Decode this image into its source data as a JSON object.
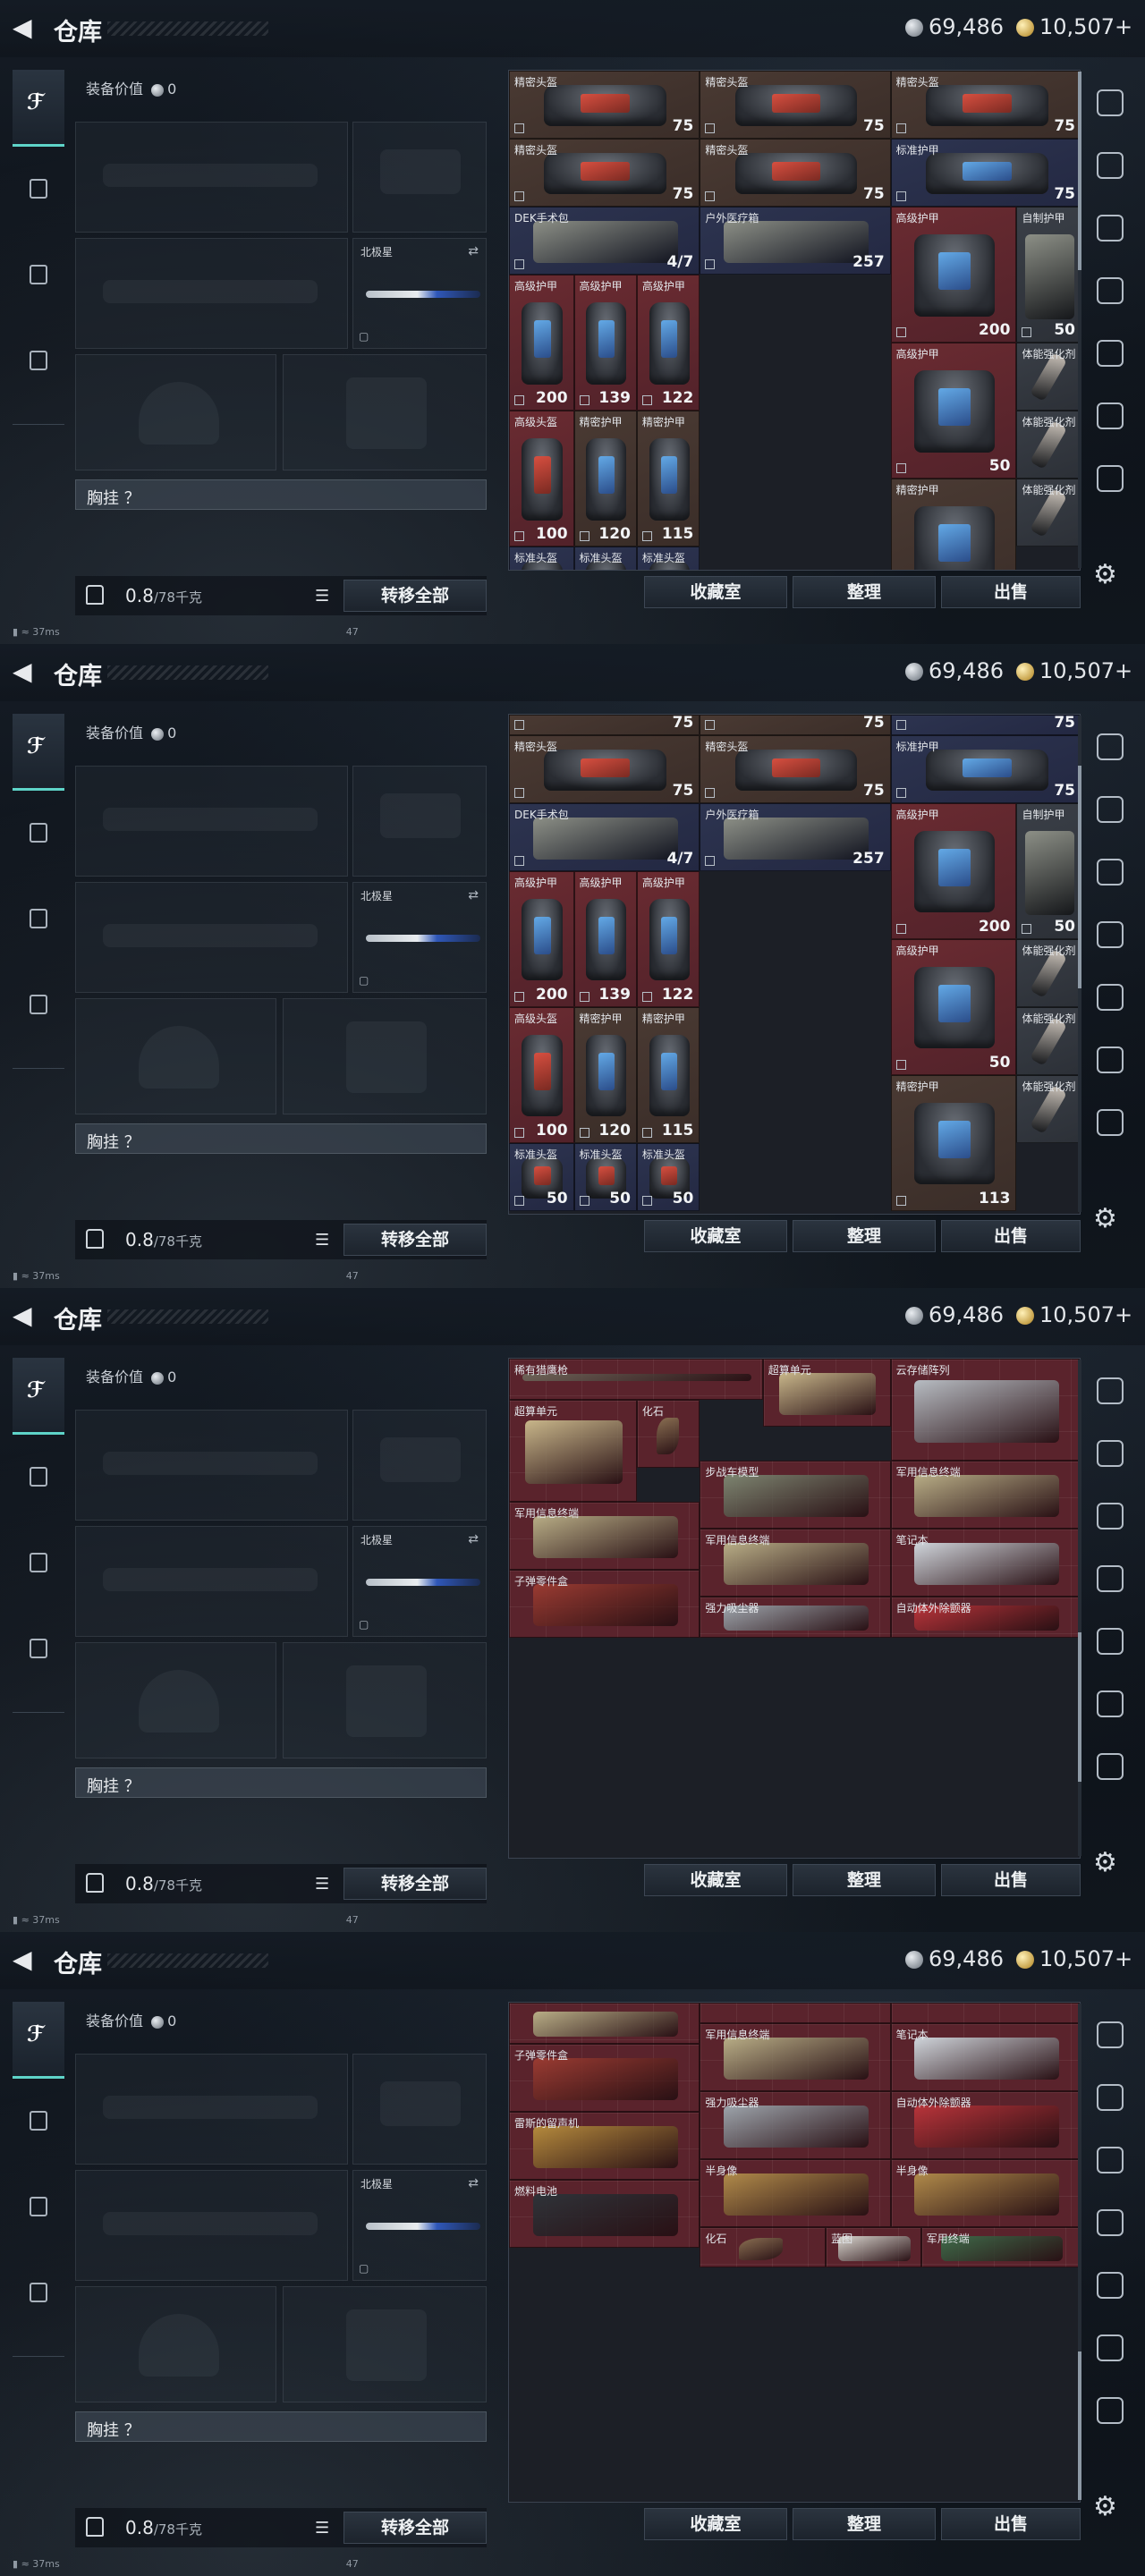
{
  "header": {
    "title": "仓库",
    "silver": "69,486",
    "gold": "10,507+"
  },
  "equipment": {
    "value_label": "装备价值",
    "value": "0",
    "knife_label": "北极星",
    "rig_label": "胸挂 ？"
  },
  "bottom": {
    "weight": "0.8",
    "weight_max": "/78千克",
    "transfer_all": "转移全部",
    "collection": "收藏室",
    "organize": "整理",
    "sell": "出售"
  },
  "status": {
    "ping": "37ms",
    "num": "47"
  },
  "panels": [
    {
      "scroll": {
        "from": 0.0,
        "to": 0.4
      },
      "cells": [
        {
          "name": "精密头盔",
          "val": "75",
          "c": 0,
          "r": 0,
          "w": 1,
          "h": 1,
          "k": "brown",
          "art": "bag-red"
        },
        {
          "name": "精密头盔",
          "val": "75",
          "c": 1,
          "r": 0,
          "w": 1,
          "h": 1,
          "k": "brown",
          "art": "bag-red"
        },
        {
          "name": "精密头盔",
          "val": "75",
          "c": 2,
          "r": 0,
          "w": 1,
          "h": 1,
          "k": "brown",
          "art": "bag-red"
        },
        {
          "name": "精密头盔",
          "val": "75",
          "c": 0,
          "r": 1,
          "w": 1,
          "h": 1,
          "k": "brown",
          "art": "bag-red"
        },
        {
          "name": "精密头盔",
          "val": "75",
          "c": 1,
          "r": 1,
          "w": 1,
          "h": 1,
          "k": "brown",
          "art": "bag-red"
        },
        {
          "name": "标准护甲",
          "val": "75",
          "c": 2,
          "r": 1,
          "w": 1,
          "h": 1,
          "k": "blue",
          "art": "bag-blue"
        },
        {
          "name": "DEK手术包",
          "val": "4/7",
          "c": 0,
          "r": 2,
          "w": 1,
          "h": 1,
          "k": "blue",
          "art": "box"
        },
        {
          "name": "户外医疗箱",
          "val": "257",
          "c": 1,
          "r": 2,
          "w": 1,
          "h": 1,
          "k": "blue",
          "art": "box"
        },
        {
          "name": "高级护甲",
          "val": "200",
          "c": 2,
          "r": 2,
          "w": 0.66,
          "h": 2,
          "k": "red",
          "art": "bag-blue"
        },
        {
          "name": "自制护甲",
          "val": "50",
          "c": 2.66,
          "r": 2,
          "w": 0.34,
          "h": 2,
          "k": "gray",
          "art": "box"
        },
        {
          "name": "高级护甲",
          "val": "200",
          "c": 0,
          "r": 3,
          "w": 0.34,
          "h": 2,
          "k": "red",
          "art": "bag-blue"
        },
        {
          "name": "高级护甲",
          "val": "139",
          "c": 0.34,
          "r": 3,
          "w": 0.33,
          "h": 2,
          "k": "red",
          "art": "bag-blue"
        },
        {
          "name": "高级护甲",
          "val": "122",
          "c": 0.67,
          "r": 3,
          "w": 0.33,
          "h": 2,
          "k": "red",
          "art": "bag-blue"
        },
        {
          "name": "高级护甲",
          "val": "50",
          "c": 2,
          "r": 4,
          "w": 0.66,
          "h": 2,
          "k": "red",
          "art": "bag-blue"
        },
        {
          "name": "体能强化剂",
          "val": "",
          "c": 2.66,
          "r": 4,
          "w": 0.34,
          "h": 1,
          "k": "gray",
          "art": "syringe"
        },
        {
          "name": "高级头盔",
          "val": "100",
          "c": 0,
          "r": 5,
          "w": 0.34,
          "h": 2,
          "k": "red",
          "art": "bag-red"
        },
        {
          "name": "精密护甲",
          "val": "120",
          "c": 0.34,
          "r": 5,
          "w": 0.33,
          "h": 2,
          "k": "brown",
          "art": "bag-blue"
        },
        {
          "name": "精密护甲",
          "val": "115",
          "c": 0.67,
          "r": 5,
          "w": 0.33,
          "h": 2,
          "k": "brown",
          "art": "bag-blue"
        },
        {
          "name": "体能强化剂",
          "val": "",
          "c": 2.66,
          "r": 5,
          "w": 0.34,
          "h": 1,
          "k": "gray",
          "art": "syringe"
        },
        {
          "name": "精密护甲",
          "val": "113",
          "c": 2,
          "r": 6,
          "w": 0.66,
          "h": 2,
          "k": "brown",
          "art": "bag-blue"
        },
        {
          "name": "体能强化剂",
          "val": "",
          "c": 2.66,
          "r": 6,
          "w": 0.34,
          "h": 1,
          "k": "gray",
          "art": "syringe"
        },
        {
          "name": "标准头盔",
          "val": "50",
          "c": 0,
          "r": 7,
          "w": 0.34,
          "h": 1,
          "k": "blue",
          "art": "bag-red"
        },
        {
          "name": "标准头盔",
          "val": "50",
          "c": 0.34,
          "r": 7,
          "w": 0.33,
          "h": 1,
          "k": "blue",
          "art": "bag-red"
        },
        {
          "name": "标准头盔",
          "val": "50",
          "c": 0.67,
          "r": 7,
          "w": 0.33,
          "h": 1,
          "k": "blue",
          "art": "bag-red"
        }
      ]
    },
    {
      "scroll": {
        "from": 0.1,
        "to": 0.55
      },
      "cells": [
        {
          "name": "",
          "val": "75",
          "c": 0,
          "r": 0,
          "w": 1,
          "h": 0.3,
          "k": "brown",
          "art": ""
        },
        {
          "name": "",
          "val": "75",
          "c": 1,
          "r": 0,
          "w": 1,
          "h": 0.3,
          "k": "brown",
          "art": ""
        },
        {
          "name": "",
          "val": "75",
          "c": 2,
          "r": 0,
          "w": 1,
          "h": 0.3,
          "k": "blue",
          "art": ""
        },
        {
          "name": "精密头盔",
          "val": "75",
          "c": 0,
          "r": 0.3,
          "w": 1,
          "h": 1,
          "k": "brown",
          "art": "bag-red"
        },
        {
          "name": "精密头盔",
          "val": "75",
          "c": 1,
          "r": 0.3,
          "w": 1,
          "h": 1,
          "k": "brown",
          "art": "bag-red"
        },
        {
          "name": "标准护甲",
          "val": "75",
          "c": 2,
          "r": 0.3,
          "w": 1,
          "h": 1,
          "k": "blue",
          "art": "bag-blue"
        },
        {
          "name": "DEK手术包",
          "val": "4/7",
          "c": 0,
          "r": 1.3,
          "w": 1,
          "h": 1,
          "k": "blue",
          "art": "box"
        },
        {
          "name": "户外医疗箱",
          "val": "257",
          "c": 1,
          "r": 1.3,
          "w": 1,
          "h": 1,
          "k": "blue",
          "art": "box"
        },
        {
          "name": "高级护甲",
          "val": "200",
          "c": 2,
          "r": 1.3,
          "w": 0.66,
          "h": 2,
          "k": "red",
          "art": "bag-blue"
        },
        {
          "name": "自制护甲",
          "val": "50",
          "c": 2.66,
          "r": 1.3,
          "w": 0.34,
          "h": 2,
          "k": "gray",
          "art": "box"
        },
        {
          "name": "高级护甲",
          "val": "200",
          "c": 0,
          "r": 2.3,
          "w": 0.34,
          "h": 2,
          "k": "red",
          "art": "bag-blue"
        },
        {
          "name": "高级护甲",
          "val": "139",
          "c": 0.34,
          "r": 2.3,
          "w": 0.33,
          "h": 2,
          "k": "red",
          "art": "bag-blue"
        },
        {
          "name": "高级护甲",
          "val": "122",
          "c": 0.67,
          "r": 2.3,
          "w": 0.33,
          "h": 2,
          "k": "red",
          "art": "bag-blue"
        },
        {
          "name": "高级护甲",
          "val": "50",
          "c": 2,
          "r": 3.3,
          "w": 0.66,
          "h": 2,
          "k": "red",
          "art": "bag-blue"
        },
        {
          "name": "体能强化剂",
          "val": "",
          "c": 2.66,
          "r": 3.3,
          "w": 0.34,
          "h": 1,
          "k": "gray",
          "art": "syringe"
        },
        {
          "name": "高级头盔",
          "val": "100",
          "c": 0,
          "r": 4.3,
          "w": 0.34,
          "h": 2,
          "k": "red",
          "art": "bag-red"
        },
        {
          "name": "精密护甲",
          "val": "120",
          "c": 0.34,
          "r": 4.3,
          "w": 0.33,
          "h": 2,
          "k": "brown",
          "art": "bag-blue"
        },
        {
          "name": "精密护甲",
          "val": "115",
          "c": 0.67,
          "r": 4.3,
          "w": 0.33,
          "h": 2,
          "k": "brown",
          "art": "bag-blue"
        },
        {
          "name": "体能强化剂",
          "val": "",
          "c": 2.66,
          "r": 4.3,
          "w": 0.34,
          "h": 1,
          "k": "gray",
          "art": "syringe"
        },
        {
          "name": "精密护甲",
          "val": "113",
          "c": 2,
          "r": 5.3,
          "w": 0.66,
          "h": 2,
          "k": "brown",
          "art": "bag-blue"
        },
        {
          "name": "体能强化剂",
          "val": "",
          "c": 2.66,
          "r": 5.3,
          "w": 0.34,
          "h": 1,
          "k": "gray",
          "art": "syringe"
        },
        {
          "name": "标准头盔",
          "val": "50",
          "c": 0,
          "r": 6.3,
          "w": 0.34,
          "h": 1,
          "k": "blue",
          "art": "bag-red"
        },
        {
          "name": "标准头盔",
          "val": "50",
          "c": 0.34,
          "r": 6.3,
          "w": 0.33,
          "h": 1,
          "k": "blue",
          "art": "bag-red"
        },
        {
          "name": "标准头盔",
          "val": "50",
          "c": 0.67,
          "r": 6.3,
          "w": 0.33,
          "h": 1,
          "k": "blue",
          "art": "bag-red"
        }
      ]
    },
    {
      "scroll": {
        "from": 0.55,
        "to": 0.85
      },
      "cells": [
        {
          "name": "稀有猎鹰枪",
          "val": "",
          "c": 0,
          "r": 0,
          "w": 1.33,
          "h": 0.6,
          "k": "grid-bg",
          "art": "rifle"
        },
        {
          "name": "超算单元",
          "val": "",
          "c": 1.33,
          "r": 0,
          "w": 0.67,
          "h": 1,
          "k": "grid-bg",
          "art": "board"
        },
        {
          "name": "云存储阵列",
          "val": "",
          "c": 2,
          "r": 0,
          "w": 1,
          "h": 1.5,
          "k": "grid-bg",
          "art": "server"
        },
        {
          "name": "超算单元",
          "val": "",
          "c": 0,
          "r": 0.6,
          "w": 0.67,
          "h": 1.5,
          "k": "grid-bg",
          "art": "board"
        },
        {
          "name": "化石",
          "val": "",
          "c": 0.67,
          "r": 0.6,
          "w": 0.33,
          "h": 1,
          "k": "grid-bg",
          "art": "claw"
        },
        {
          "name": "步战车模型",
          "val": "",
          "c": 1,
          "r": 1.5,
          "w": 1,
          "h": 1,
          "k": "grid-bg",
          "art": "tank"
        },
        {
          "name": "军用信息终端",
          "val": "",
          "c": 2,
          "r": 1.5,
          "w": 1,
          "h": 1,
          "k": "grid-bg",
          "art": "terminal"
        },
        {
          "name": "军用信息终端",
          "val": "",
          "c": 0,
          "r": 2.1,
          "w": 1,
          "h": 1,
          "k": "grid-bg",
          "art": "terminal"
        },
        {
          "name": "军用信息终端",
          "val": "",
          "c": 1,
          "r": 2.5,
          "w": 1,
          "h": 1,
          "k": "grid-bg",
          "art": "terminal"
        },
        {
          "name": "笔记本",
          "val": "",
          "c": 2,
          "r": 2.5,
          "w": 1,
          "h": 1,
          "k": "grid-bg",
          "art": "laptop"
        },
        {
          "name": "子弹零件盒",
          "val": "",
          "c": 0,
          "r": 3.1,
          "w": 1,
          "h": 1,
          "k": "grid-bg",
          "art": "kit"
        },
        {
          "name": "强力吸尘器",
          "val": "",
          "c": 1,
          "r": 3.5,
          "w": 1,
          "h": 0.6,
          "k": "grid-bg",
          "art": "vacuum"
        },
        {
          "name": "自动体外除颤器",
          "val": "",
          "c": 2,
          "r": 3.5,
          "w": 1,
          "h": 0.6,
          "k": "grid-bg",
          "art": "aed"
        }
      ]
    },
    {
      "scroll": {
        "from": 0.7,
        "to": 1.0
      },
      "cells": [
        {
          "name": "",
          "val": "",
          "c": 0,
          "r": 0,
          "w": 1,
          "h": 0.6,
          "k": "grid-bg",
          "art": "terminal"
        },
        {
          "name": "",
          "val": "",
          "c": 1,
          "r": 0,
          "w": 1,
          "h": 0.3,
          "k": "grid-bg",
          "art": ""
        },
        {
          "name": "",
          "val": "",
          "c": 2,
          "r": 0,
          "w": 1,
          "h": 0.3,
          "k": "grid-bg",
          "art": ""
        },
        {
          "name": "军用信息终端",
          "val": "",
          "c": 1,
          "r": 0.3,
          "w": 1,
          "h": 1,
          "k": "grid-bg",
          "art": "terminal"
        },
        {
          "name": "笔记本",
          "val": "",
          "c": 2,
          "r": 0.3,
          "w": 1,
          "h": 1,
          "k": "grid-bg",
          "art": "laptop"
        },
        {
          "name": "子弹零件盒",
          "val": "",
          "c": 0,
          "r": 0.6,
          "w": 1,
          "h": 1,
          "k": "grid-bg",
          "art": "kit"
        },
        {
          "name": "强力吸尘器",
          "val": "",
          "c": 1,
          "r": 1.3,
          "w": 1,
          "h": 1,
          "k": "grid-bg",
          "art": "vacuum"
        },
        {
          "name": "自动体外除颤器",
          "val": "",
          "c": 2,
          "r": 1.3,
          "w": 1,
          "h": 1,
          "k": "grid-bg",
          "art": "aed"
        },
        {
          "name": "雷斯的留声机",
          "val": "",
          "c": 0,
          "r": 1.6,
          "w": 1,
          "h": 1,
          "k": "grid-bg",
          "art": "phono"
        },
        {
          "name": "半身像",
          "val": "",
          "c": 1,
          "r": 2.3,
          "w": 1,
          "h": 1,
          "k": "grid-bg",
          "art": "bust"
        },
        {
          "name": "半身像",
          "val": "",
          "c": 2,
          "r": 2.3,
          "w": 1,
          "h": 1,
          "k": "grid-bg",
          "art": "bust"
        },
        {
          "name": "燃料电池",
          "val": "",
          "c": 0,
          "r": 2.6,
          "w": 1,
          "h": 1,
          "k": "grid-bg",
          "art": "battery"
        },
        {
          "name": "化石",
          "val": "",
          "c": 1,
          "r": 3.3,
          "w": 0.66,
          "h": 0.6,
          "k": "grid-bg",
          "art": "claw"
        },
        {
          "name": "蓝图",
          "val": "",
          "c": 1.66,
          "r": 3.3,
          "w": 0.5,
          "h": 0.6,
          "k": "grid-bg",
          "art": "map"
        },
        {
          "name": "军用终端",
          "val": "",
          "c": 2.16,
          "r": 3.3,
          "w": 0.84,
          "h": 0.6,
          "k": "grid-bg",
          "art": "pcb"
        }
      ]
    }
  ]
}
